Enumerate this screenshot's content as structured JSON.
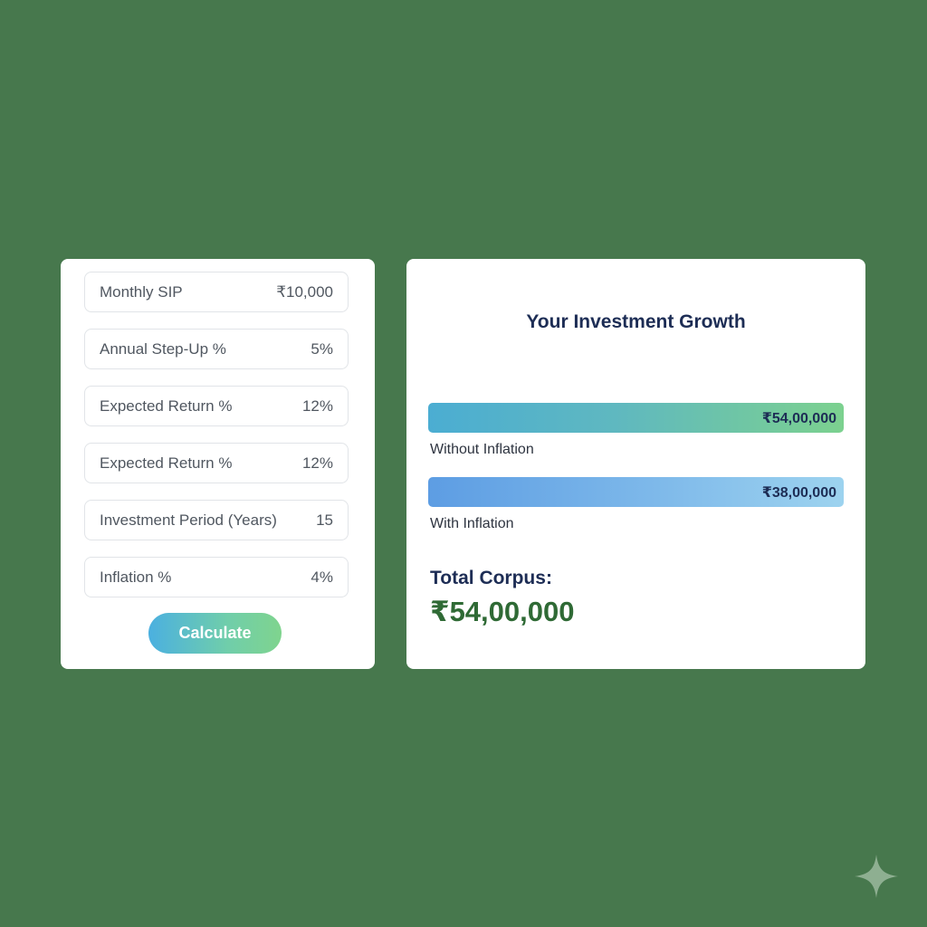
{
  "inputs": {
    "fields": [
      {
        "label": "Monthly SIP",
        "value": "₹10,000"
      },
      {
        "label": "Annual Step-Up %",
        "value": "5%"
      },
      {
        "label": "Expected Return %",
        "value": "12%"
      },
      {
        "label": "Expected Return %",
        "value": "12%"
      },
      {
        "label": "Investment Period (Years)",
        "value": "15"
      },
      {
        "label": "Inflation %",
        "value": "4%"
      }
    ],
    "calculate_label": "Calculate"
  },
  "growth": {
    "title": "Your Investment Growth",
    "bars": [
      {
        "value_text": "₹54,00,000",
        "label": "Without Inflation",
        "fill_fraction": 1.0
      },
      {
        "value_text": "₹38,00,000",
        "label": "With Inflation",
        "fill_fraction": 1.0
      }
    ],
    "total_label": "Total Corpus:",
    "total_value": "₹54,00,000"
  },
  "icons": {
    "sparkle": "sparkle-icon"
  }
}
